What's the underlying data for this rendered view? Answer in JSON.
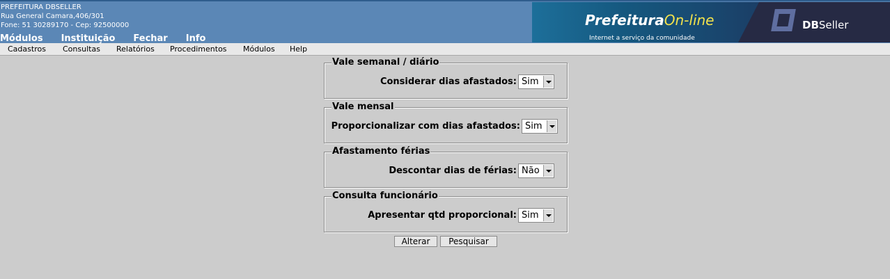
{
  "header": {
    "org_name": "PREFEITURA DBSELLER",
    "address": "Rua General Camara,406/301",
    "phone_line": "Fone: 51 30289170  -  Cep: 92500000",
    "top_nav": [
      "Módulos",
      "Instituição",
      "Fechar",
      "Info"
    ]
  },
  "banner": {
    "po_brand": "Prefeitura",
    "po_brand_accent": "On-line",
    "po_tagline": "Internet a serviço da comunidade",
    "db_brand_bold": "DB",
    "db_brand_rest": "Seller"
  },
  "menu": [
    "Cadastros",
    "Consultas",
    "Relatórios",
    "Procedimentos",
    "Módulos",
    "Help"
  ],
  "sections": [
    {
      "legend": "Vale semanal / diário",
      "label": "Considerar dias afastados:",
      "value": "Sim"
    },
    {
      "legend": "Vale mensal",
      "label": "Proporcionalizar com dias afastados:",
      "value": "Sim"
    },
    {
      "legend": "Afastamento férias",
      "label": "Descontar dias de férias:",
      "value": "Não"
    },
    {
      "legend": "Consulta funcionário",
      "label": "Apresentar qtd proporcional:",
      "value": "Sim"
    }
  ],
  "actions": {
    "alterar": "Alterar",
    "pesquisar": "Pesquisar"
  },
  "colors": {
    "header_bg": "#5b87b6",
    "page_bg": "#cccccc",
    "banner_accent": "#f3e24b",
    "db_bg": "#262a44"
  }
}
